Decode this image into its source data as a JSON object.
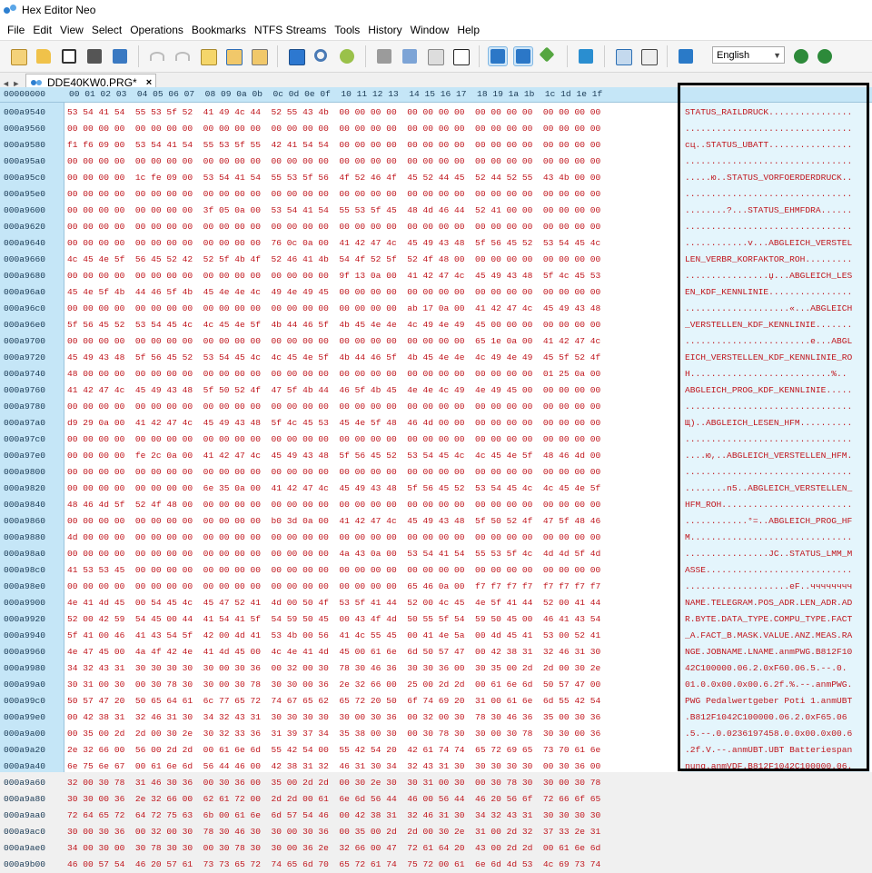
{
  "app": {
    "title": "Hex Editor Neo"
  },
  "menu": [
    "File",
    "Edit",
    "View",
    "Select",
    "Operations",
    "Bookmarks",
    "NTFS Streams",
    "Tools",
    "History",
    "Window",
    "Help"
  ],
  "toolbar": {
    "language": "English",
    "icons": [
      "new-icon",
      "open-icon",
      "save-icon",
      "save-all-icon",
      "save-as-icon",
      "undo-icon",
      "redo-icon",
      "edit-icon",
      "copy-icon",
      "paste-icon",
      "export-icon",
      "find-icon",
      "find-in-files-icon",
      "pattern-icon",
      "structure-icon",
      "columns-icon",
      "binary-icon",
      "hex-view-icon",
      "text-view-icon",
      "highlight-icon",
      "compare-icon",
      "search-icon",
      "scripts-icon",
      "help-icon"
    ]
  },
  "tab": {
    "nav": "◄ ►",
    "label": "DDE40KW0.PRG*",
    "close": "×"
  },
  "editor": {
    "corner": "00000000",
    "col_headers": "00 01 02 03  04 05 06 07  08 09 0a 0b  0c 0d 0e 0f  10 11 12 13  14 15 16 17  18 19 1a 1b  1c 1d 1e 1f",
    "rows": [
      {
        "o": "000a9540",
        "h": "53 54 41 54  55 53 5f 52  41 49 4c 44  52 55 43 4b  00 00 00 00  00 00 00 00  00 00 00 00  00 00 00 00",
        "a": "STATUS_RAILDRUCK................"
      },
      {
        "o": "000a9560",
        "h": "00 00 00 00  00 00 00 00  00 00 00 00  00 00 00 00  00 00 00 00  00 00 00 00  00 00 00 00  00 00 00 00",
        "a": "................................"
      },
      {
        "o": "000a9580",
        "h": "f1 f6 09 00  53 54 41 54  55 53 5f 55  42 41 54 54  00 00 00 00  00 00 00 00  00 00 00 00  00 00 00 00",
        "a": "сц..STATUS_UBATT................"
      },
      {
        "o": "000a95a0",
        "h": "00 00 00 00  00 00 00 00  00 00 00 00  00 00 00 00  00 00 00 00  00 00 00 00  00 00 00 00  00 00 00 00",
        "a": "................................"
      },
      {
        "o": "000a95c0",
        "h": "00 00 00 00  1c fe 09 00  53 54 41 54  55 53 5f 56  4f 52 46 4f  45 52 44 45  52 44 52 55  43 4b 00 00",
        "a": ".....ю..STATUS_VORFOERDERDRUCK.."
      },
      {
        "o": "000a95e0",
        "h": "00 00 00 00  00 00 00 00  00 00 00 00  00 00 00 00  00 00 00 00  00 00 00 00  00 00 00 00  00 00 00 00",
        "a": "................................"
      },
      {
        "o": "000a9600",
        "h": "00 00 00 00  00 00 00 00  3f 05 0a 00  53 54 41 54  55 53 5f 45  48 4d 46 44  52 41 00 00  00 00 00 00",
        "a": "........?...STATUS_EHMFDRA......"
      },
      {
        "o": "000a9620",
        "h": "00 00 00 00  00 00 00 00  00 00 00 00  00 00 00 00  00 00 00 00  00 00 00 00  00 00 00 00  00 00 00 00",
        "a": "................................"
      },
      {
        "o": "000a9640",
        "h": "00 00 00 00  00 00 00 00  00 00 00 00  76 0c 0a 00  41 42 47 4c  45 49 43 48  5f 56 45 52  53 54 45 4c",
        "a": "............v...ABGLEICH_VERSTEL"
      },
      {
        "o": "000a9660",
        "h": "4c 45 4e 5f  56 45 52 42  52 5f 4b 4f  52 46 41 4b  54 4f 52 5f  52 4f 48 00  00 00 00 00  00 00 00 00",
        "a": "LEN_VERBR_KORFAKTOR_ROH........."
      },
      {
        "o": "000a9680",
        "h": "00 00 00 00  00 00 00 00  00 00 00 00  00 00 00 00  9f 13 0a 00  41 42 47 4c  45 49 43 48  5f 4c 45 53",
        "a": "................џ...ABGLEICH_LES"
      },
      {
        "o": "000a96a0",
        "h": "45 4e 5f 4b  44 46 5f 4b  45 4e 4e 4c  49 4e 49 45  00 00 00 00  00 00 00 00  00 00 00 00  00 00 00 00",
        "a": "EN_KDF_KENNLINIE................"
      },
      {
        "o": "000a96c0",
        "h": "00 00 00 00  00 00 00 00  00 00 00 00  00 00 00 00  00 00 00 00  ab 17 0a 00  41 42 47 4c  45 49 43 48",
        "a": "....................«...ABGLEICH"
      },
      {
        "o": "000a96e0",
        "h": "5f 56 45 52  53 54 45 4c  4c 45 4e 5f  4b 44 46 5f  4b 45 4e 4e  4c 49 4e 49  45 00 00 00  00 00 00 00",
        "a": "_VERSTELLEN_KDF_KENNLINIE......."
      },
      {
        "o": "000a9700",
        "h": "00 00 00 00  00 00 00 00  00 00 00 00  00 00 00 00  00 00 00 00  00 00 00 00  65 1e 0a 00  41 42 47 4c",
        "a": "........................e...ABGL"
      },
      {
        "o": "000a9720",
        "h": "45 49 43 48  5f 56 45 52  53 54 45 4c  4c 45 4e 5f  4b 44 46 5f  4b 45 4e 4e  4c 49 4e 49  45 5f 52 4f",
        "a": "EICH_VERSTELLEN_KDF_KENNLINIE_RO"
      },
      {
        "o": "000a9740",
        "h": "48 00 00 00  00 00 00 00  00 00 00 00  00 00 00 00  00 00 00 00  00 00 00 00  00 00 00 00  01 25 0a 00",
        "a": "H...........................%.."
      },
      {
        "o": "000a9760",
        "h": "41 42 47 4c  45 49 43 48  5f 50 52 4f  47 5f 4b 44  46 5f 4b 45  4e 4e 4c 49  4e 49 45 00  00 00 00 00",
        "a": "ABGLEICH_PROG_KDF_KENNLINIE....."
      },
      {
        "o": "000a9780",
        "h": "00 00 00 00  00 00 00 00  00 00 00 00  00 00 00 00  00 00 00 00  00 00 00 00  00 00 00 00  00 00 00 00",
        "a": "................................"
      },
      {
        "o": "000a97a0",
        "h": "d9 29 0a 00  41 42 47 4c  45 49 43 48  5f 4c 45 53  45 4e 5f 48  46 4d 00 00  00 00 00 00  00 00 00 00",
        "a": "Щ)..ABGLEICH_LESEN_HFM.........."
      },
      {
        "o": "000a97c0",
        "h": "00 00 00 00  00 00 00 00  00 00 00 00  00 00 00 00  00 00 00 00  00 00 00 00  00 00 00 00  00 00 00 00",
        "a": "................................"
      },
      {
        "o": "000a97e0",
        "h": "00 00 00 00  fe 2c 0a 00  41 42 47 4c  45 49 43 48  5f 56 45 52  53 54 45 4c  4c 45 4e 5f  48 46 4d 00",
        "a": "....ю,..ABGLEICH_VERSTELLEN_HFM."
      },
      {
        "o": "000a9800",
        "h": "00 00 00 00  00 00 00 00  00 00 00 00  00 00 00 00  00 00 00 00  00 00 00 00  00 00 00 00  00 00 00 00",
        "a": "................................"
      },
      {
        "o": "000a9820",
        "h": "00 00 00 00  00 00 00 00  6e 35 0a 00  41 42 47 4c  45 49 43 48  5f 56 45 52  53 54 45 4c  4c 45 4e 5f",
        "a": "........n5..ABGLEICH_VERSTELLEN_"
      },
      {
        "o": "000a9840",
        "h": "48 46 4d 5f  52 4f 48 00  00 00 00 00  00 00 00 00  00 00 00 00  00 00 00 00  00 00 00 00  00 00 00 00",
        "a": "HFM_ROH........................."
      },
      {
        "o": "000a9860",
        "h": "00 00 00 00  00 00 00 00  00 00 00 00  b0 3d 0a 00  41 42 47 4c  45 49 43 48  5f 50 52 4f  47 5f 48 46",
        "a": "............°=..ABGLEICH_PROG_HF"
      },
      {
        "o": "000a9880",
        "h": "4d 00 00 00  00 00 00 00  00 00 00 00  00 00 00 00  00 00 00 00  00 00 00 00  00 00 00 00  00 00 00 00",
        "a": "M..............................."
      },
      {
        "o": "000a98a0",
        "h": "00 00 00 00  00 00 00 00  00 00 00 00  00 00 00 00  4a 43 0a 00  53 54 41 54  55 53 5f 4c  4d 4d 5f 4d",
        "a": "................JC..STATUS_LMM_M"
      },
      {
        "o": "000a98c0",
        "h": "41 53 53 45  00 00 00 00  00 00 00 00  00 00 00 00  00 00 00 00  00 00 00 00  00 00 00 00  00 00 00 00",
        "a": "ASSE............................"
      },
      {
        "o": "000a98e0",
        "h": "00 00 00 00  00 00 00 00  00 00 00 00  00 00 00 00  00 00 00 00  65 46 0a 00  f7 f7 f7 f7  f7 f7 f7 f7",
        "a": "....................eF..чччччччч"
      },
      {
        "o": "000a9900",
        "h": "4e 41 4d 45  00 54 45 4c  45 47 52 41  4d 00 50 4f  53 5f 41 44  52 00 4c 45  4e 5f 41 44  52 00 41 44",
        "a": "NAME.TELEGRAM.POS_ADR.LEN_ADR.AD"
      },
      {
        "o": "000a9920",
        "h": "52 00 42 59  54 45 00 44  41 54 41 5f  54 59 50 45  00 43 4f 4d  50 55 5f 54  59 50 45 00  46 41 43 54",
        "a": "R.BYTE.DATA_TYPE.COMPU_TYPE.FACT"
      },
      {
        "o": "000a9940",
        "h": "5f 41 00 46  41 43 54 5f  42 00 4d 41  53 4b 00 56  41 4c 55 45  00 41 4e 5a  00 4d 45 41  53 00 52 41",
        "a": "_A.FACT_B.MASK.VALUE.ANZ.MEAS.RA"
      },
      {
        "o": "000a9960",
        "h": "4e 47 45 00  4a 4f 42 4e  41 4d 45 00  4c 4e 41 4d  45 00 61 6e  6d 50 57 47  00 42 38 31  32 46 31 30",
        "a": "NGE.JOBNAME.LNAME.anmPWG.B812F10"
      },
      {
        "o": "000a9980",
        "h": "34 32 43 31  30 30 30 30  30 00 30 36  00 32 00 30  78 30 46 36  30 30 36 00  30 35 00 2d  2d 00 30 2e",
        "a": "42C100000.06.2.0xF60.06.5.--.0."
      },
      {
        "o": "000a99a0",
        "h": "30 31 00 30  00 30 78 30  30 00 30 78  30 30 00 36  2e 32 66 00  25 00 2d 2d  00 61 6e 6d  50 57 47 00",
        "a": "01.0.0x00.0x00.6.2f.%.--.anmPWG."
      },
      {
        "o": "000a99c0",
        "h": "50 57 47 20  50 65 64 61  6c 77 65 72  74 67 65 62  65 72 20 50  6f 74 69 20  31 00 61 6e  6d 55 42 54",
        "a": "PWG Pedalwertgeber Poti 1.anmUBT"
      },
      {
        "o": "000a99e0",
        "h": "00 42 38 31  32 46 31 30  34 32 43 31  30 30 30 30  30 00 30 36  00 32 00 30  78 30 46 36  35 00 30 36",
        "a": ".B812F1042C100000.06.2.0xF65.06"
      },
      {
        "o": "000a9a00",
        "h": "00 35 00 2d  2d 00 30 2e  30 32 33 36  31 39 37 34  35 38 00 30  00 30 78 30  30 00 30 78  30 30 00 36",
        "a": ".5.--.0.0236197458.0.0x00.0x00.6"
      },
      {
        "o": "000a9a20",
        "h": "2e 32 66 00  56 00 2d 2d  00 61 6e 6d  55 42 54 00  55 42 54 20  42 61 74 74  65 72 69 65  73 70 61 6e",
        "a": ".2f.V.--.anmUBT.UBT Batteriespan"
      },
      {
        "o": "000a9a40",
        "h": "6e 75 6e 67  00 61 6e 6d  56 44 46 00  42 38 31 32  46 31 30 34  32 43 31 30  30 30 30 30  00 30 36 00",
        "a": "nung.anmVDF.B812F1042C100000.06."
      },
      {
        "o": "000a9a60",
        "h": "32 00 30 78  31 46 30 36  00 30 36 00  35 00 2d 2d  00 30 2e 30  30 31 00 30  00 30 78 30  30 00 30 78",
        "a": "2.0x1F06.06.5.--.0.001.0.0x00.0x"
      },
      {
        "o": "000a9a80",
        "h": "30 30 00 36  2e 32 66 00  62 61 72 00  2d 2d 00 61  6e 6d 56 44  46 00 56 44  46 20 56 6f  72 66 6f 65",
        "a": "00.6.2f.bar.--.anmVDF.VDF Vorfoe"
      },
      {
        "o": "000a9aa0",
        "h": "72 64 65 72  64 72 75 63  6b 00 61 6e  6d 57 54 46  00 42 38 31  32 46 31 30  34 32 43 31  30 30 30 30",
        "a": "rderdruck.anmWTF.B812F1042C10000"
      },
      {
        "o": "000a9ac0",
        "h": "30 00 30 36  00 32 00 30  78 30 46 30  30 00 30 36  00 35 00 2d  2d 00 30 2e  31 00 2d 32  37 33 2e 31",
        "a": "0.06.2.0x0F00.06.5.--.0.1.-273.1"
      },
      {
        "o": "000a9ae0",
        "h": "34 00 30 00  30 78 30 30  00 30 78 30  30 00 36 2e  32 66 00 47  72 61 64 20  43 00 2d 2d  00 61 6e 6d",
        "a": "4.0x00.0x00.6.2f.Grad C.--.anm"
      },
      {
        "o": "000a9b00",
        "h": "46 00 57 54  46 20 57 61  73 73 65 72  74 65 6d 70  65 72 61 74  75 72 00 61  6e 6d 4d 53  4c 69 73 74",
        "a": "F.WTF Wassertemperatur.anmM List"
      }
    ]
  },
  "colors": {
    "hex_text": "#c0161d",
    "offset_bg": "#c5e6f7",
    "ascii_bg": "#e4f5fc",
    "highlight_border": "#000000"
  }
}
